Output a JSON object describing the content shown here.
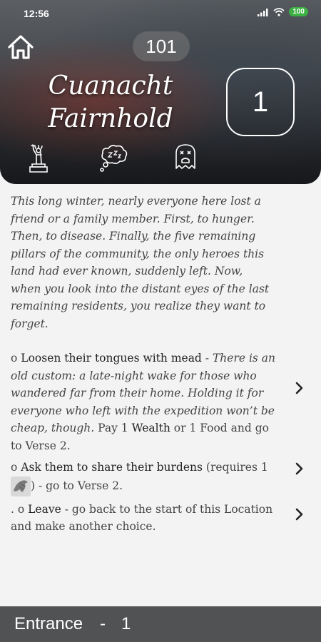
{
  "status": {
    "time": "12:56",
    "battery": "100"
  },
  "header": {
    "verse_number": "101",
    "location_name_line1": "Cuanacht",
    "location_name_line2": "Fairnhold",
    "counter": "1",
    "icons": [
      "statue-of-liberty-icon",
      "thought-bubble-icon",
      "ghost-icon"
    ]
  },
  "intro": "This long winter, nearly everyone here lost a friend or a family member. First, to hunger. Then, to disease. Finally, the five remaining pillars of the community, the only heroes this land had ever known, suddenly left. Now, when you look into the distant eyes of the last remaining residents, you realize they want to forget.",
  "choices": [
    {
      "bullet": "o",
      "label": "Loosen their tongues with mead",
      "sep": " - ",
      "desc": "There is an old    custom: a late-night wake for those who wandered far from their home. Holding it for everyone who left with the expedition won’t be cheap, though.",
      "pay_prefix": " Pay 1 ",
      "pay_resource": "Wealth",
      "pay_suffix": " or 1 Food and go to Verse 2."
    },
    {
      "bullet": "o",
      "label": "Ask them to share their burdens",
      "requires": " (requires 1 ",
      "after": ") - go to Verse 2."
    },
    {
      "bullet": ". o",
      "label": "Leave",
      "rest": " - go back to the start of this Location and make another choice."
    }
  ],
  "footer": {
    "label": "Entrance",
    "dash": "-",
    "number": "1"
  }
}
